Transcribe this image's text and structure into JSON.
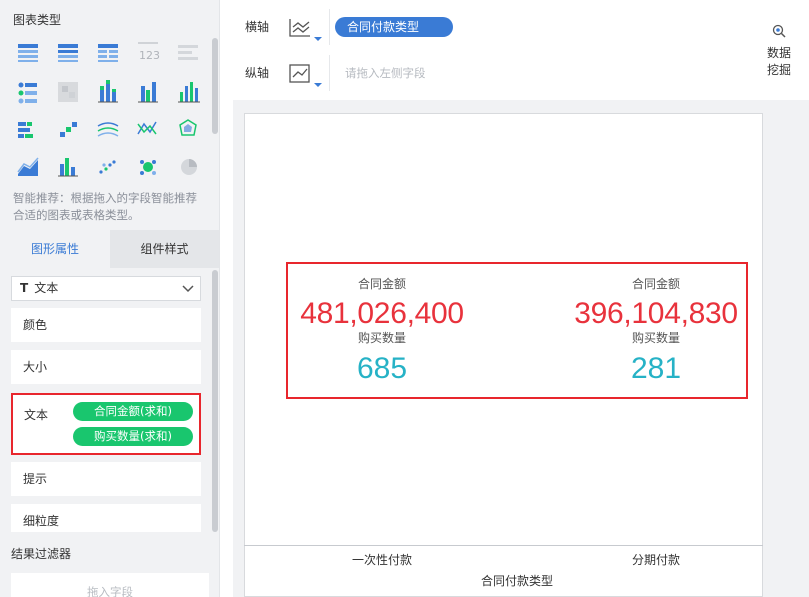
{
  "left": {
    "chart_types_title": "图表类型",
    "recommend_tip": "智能推荐：根据拖入的字段智能推荐合适的图表或表格类型。",
    "tabs": [
      "图形属性",
      "组件样式"
    ],
    "mark_select": "文本",
    "props": {
      "color": "颜色",
      "size": "大小",
      "text": "文本",
      "text_fields": [
        "合同金额(求和)",
        "购买数量(求和)"
      ],
      "hint": "提示",
      "granularity": "细粒度"
    },
    "filter_title": "结果过滤器",
    "filter_placeholder": "拖入字段"
  },
  "axis": {
    "x_label": "横轴",
    "x_field": "合同付款类型",
    "y_label": "纵轴",
    "y_placeholder": "请拖入左侧字段"
  },
  "mine_button": "数据挖掘",
  "accent_color": "#3a7bd5",
  "highlight_color": "#e8262d",
  "chart_data": {
    "type": "table",
    "x_title": "合同付款类型",
    "categories": [
      "一次性付款",
      "分期付款"
    ],
    "amount_label": "合同金额",
    "quantity_label": "购买数量",
    "amount_values": [
      "481,026,400",
      "396,104,830"
    ],
    "quantity_values": [
      "685",
      "281"
    ]
  }
}
